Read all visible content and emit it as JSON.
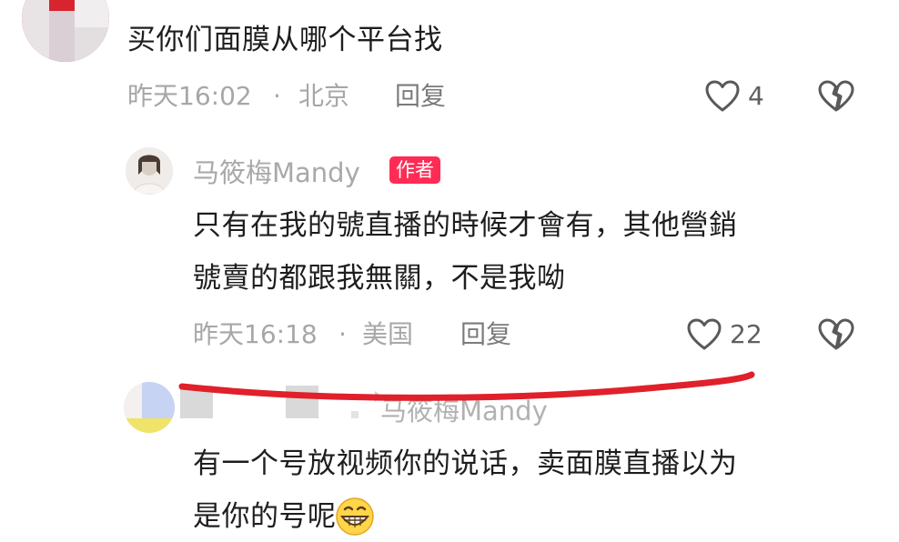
{
  "comment1": {
    "text": "买你们面膜从哪个平台找",
    "time": "昨天16:02",
    "sep": "·",
    "location": "北京",
    "reply_label": "回复",
    "likes": "4"
  },
  "reply1": {
    "username": "马筱梅Mandy",
    "badge": "作者",
    "line1": "只有在我的號直播的時候才會有，其他營銷",
    "line2": "號賣的都跟我無關，不是我呦",
    "time": "昨天16:18",
    "sep": "·",
    "location": "美国",
    "reply_label": "回复",
    "likes": "22"
  },
  "reply2": {
    "reply_to": "马筱梅Mandy",
    "line1": "有一个号放视频你的说话，卖面膜直播以为",
    "line2": "是你的号呢"
  },
  "colors": {
    "author_badge": "#fe2c55",
    "annotation_stroke": "#e0202a",
    "meta_text": "#a7a7a7"
  },
  "icons": [
    "heart-icon",
    "broken-heart-icon",
    "grin-emoji-icon"
  ]
}
